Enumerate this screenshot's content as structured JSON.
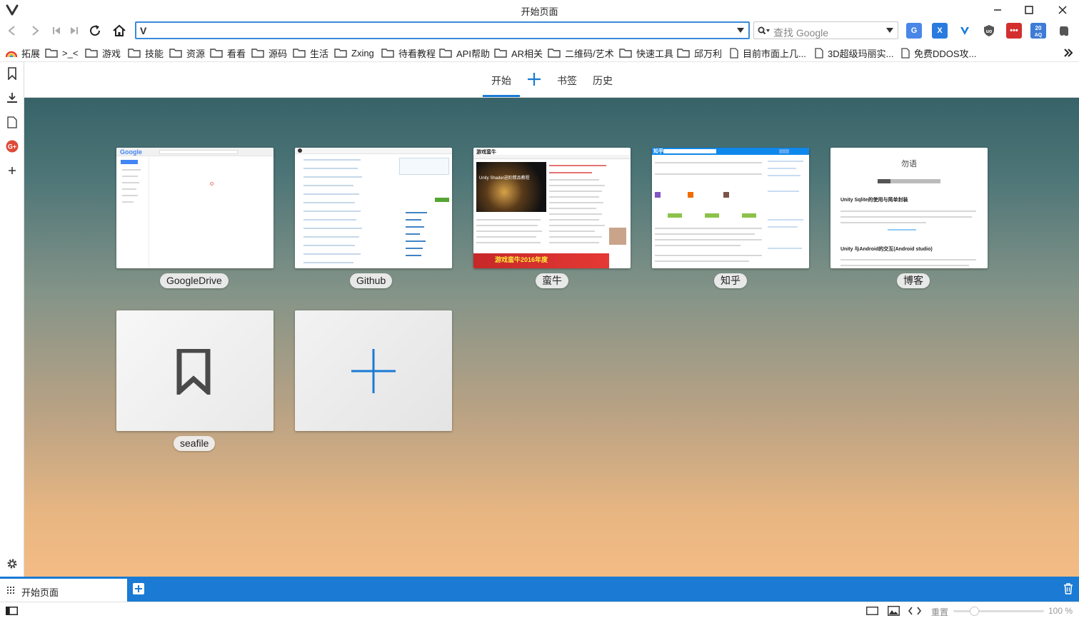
{
  "window": {
    "title": "开始页面"
  },
  "navbar": {
    "url_value": "",
    "search_placeholder": "查找 Google"
  },
  "bookmarks": [
    {
      "label": "拓展",
      "icon": "rainbow-icon"
    },
    {
      "label": ">_<",
      "icon": "folder-icon"
    },
    {
      "label": "游戏",
      "icon": "folder-icon"
    },
    {
      "label": "技能",
      "icon": "folder-icon"
    },
    {
      "label": "资源",
      "icon": "folder-icon"
    },
    {
      "label": "看看",
      "icon": "folder-icon"
    },
    {
      "label": "源码",
      "icon": "folder-icon"
    },
    {
      "label": "生活",
      "icon": "folder-icon"
    },
    {
      "label": "Zxing",
      "icon": "folder-icon"
    },
    {
      "label": "待看教程",
      "icon": "folder-icon"
    },
    {
      "label": "API帮助",
      "icon": "folder-icon"
    },
    {
      "label": "AR相关",
      "icon": "folder-icon"
    },
    {
      "label": "二维码/艺术",
      "icon": "folder-icon"
    },
    {
      "label": "快速工具",
      "icon": "folder-icon"
    },
    {
      "label": "邱万利",
      "icon": "folder-icon"
    },
    {
      "label": "目前市面上几...",
      "icon": "page-icon"
    },
    {
      "label": "3D超级玛丽实...",
      "icon": "page-icon"
    },
    {
      "label": "免费DDOS攻...",
      "icon": "page-icon"
    }
  ],
  "start_tabs": {
    "start": "开始",
    "bookmarks": "书签",
    "history": "历史"
  },
  "speed_dials": [
    {
      "label": "GoogleDrive",
      "thumb_text": "Google"
    },
    {
      "label": "Github",
      "thumb_text": ""
    },
    {
      "label": "蛮牛",
      "thumb_text": "游戏蛮牛"
    },
    {
      "label": "知乎",
      "thumb_text": "知乎"
    },
    {
      "label": "博客",
      "thumb_text": "勿语"
    },
    {
      "label": "seafile",
      "thumb_text": ""
    }
  ],
  "blog_thumb": {
    "heading1": "Unity Sqlite的使用与简单封装",
    "heading2": "Unity 与Android的交互(Android studio)"
  },
  "manniu_thumb": {
    "banner": "Unity Shader进阶精品教程",
    "red_banner": "游戏蛮牛2016年度"
  },
  "tabbar": {
    "active_tab": "开始页面"
  },
  "statusbar": {
    "reset": "重置",
    "zoom": "100 %",
    "zoom_fraction": 0.25
  },
  "colors": {
    "accent": "#1a7ad4",
    "url_border": "#3b8ad8"
  }
}
